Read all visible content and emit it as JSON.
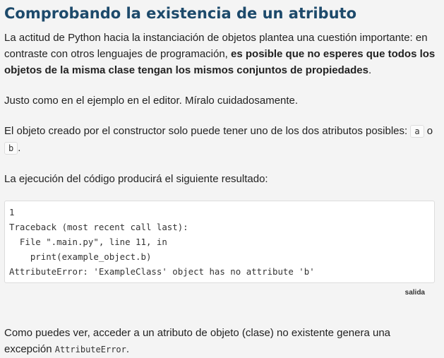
{
  "title": "Comprobando la existencia de un atributo",
  "para1": {
    "text": "La actitud de Python hacia la instanciación de objetos plantea una cuestión importante: en contraste con otros lenguajes de programación, ",
    "bold": "es posible que no esperes que todos los objetos de la misma clase tengan los mismos conjuntos de propiedades",
    "end": "."
  },
  "para2": "Justo como en el ejemplo en el editor. Míralo cuidadosamente.",
  "para3": {
    "text": "El objeto creado por el constructor solo puede tener uno de los dos atributos posibles: ",
    "code_a": "a",
    "mid": " o ",
    "code_b": "b",
    "end": "."
  },
  "para4": "La ejecución del código producirá el siguiente resultado:",
  "output_lines": [
    "1",
    "Traceback (most recent call last):",
    "  File \".main.py\", line 11, in",
    "    print(example_object.b)",
    "AttributeError: 'ExampleClass' object has no attribute 'b'"
  ],
  "caption": "salida",
  "para5": {
    "text": "Como puedes ver, acceder a un atributo de objeto (clase) no existente genera una excepción ",
    "code": "AttributeError",
    "end": "."
  }
}
